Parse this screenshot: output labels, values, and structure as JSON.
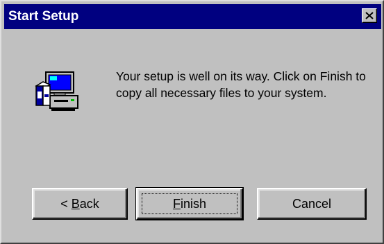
{
  "dialog": {
    "title": "Start Setup",
    "message": "Your setup is well on its way. Click on Finish to copy all necessary files to your system."
  },
  "icons": {
    "close": "close-icon",
    "setup": "computer-setup-icon"
  },
  "buttons": {
    "back": {
      "prefix": "< ",
      "mnemonic": "B",
      "rest": "ack"
    },
    "finish": {
      "mnemonic": "F",
      "rest": "inish"
    },
    "cancel": {
      "label": "Cancel"
    }
  },
  "colors": {
    "titlebar": "#000080",
    "face": "#c0c0c0"
  }
}
